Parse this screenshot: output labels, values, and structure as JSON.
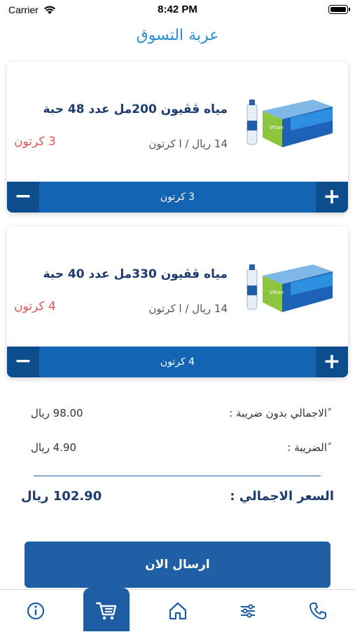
{
  "status_bar": {
    "carrier": "Carrier",
    "time": "8:42 PM"
  },
  "header": {
    "title": "عربة التسوق"
  },
  "cart": {
    "items": [
      {
        "name": "مياه ڤڤيون 200مل عدد 48 حبة",
        "price": "14 ريال / ا كرتون",
        "quantity_text": "3 كرتون",
        "stepper_text": "3 كرتون",
        "minus": "−",
        "plus": "+",
        "image": "water-box-icon"
      },
      {
        "name": "مياه ڤڤيون 330مل عدد 40 حبة",
        "price": "14 ريال / ا كرتون",
        "quantity_text": "4 كرتون",
        "stepper_text": "4 كرتون",
        "minus": "−",
        "plus": "+",
        "image": "water-box-icon"
      }
    ]
  },
  "summary": {
    "subtotal_label": "ًالاجمالي بدون ضريبة :",
    "subtotal_value": "98.00 ريال",
    "tax_label": "ًالضريبة :",
    "tax_value": "4.90 ريال",
    "total_label": "السعر الاجمالي :",
    "total_value": "102.90 ريال"
  },
  "actions": {
    "send_label": "ارسال الان"
  },
  "tab_bar": {
    "items": [
      "info-icon",
      "cart-icon",
      "home-icon",
      "sliders-icon",
      "phone-icon"
    ],
    "active": "cart-icon"
  },
  "colors": {
    "primary": "#1464b4",
    "accent_red": "#e05656",
    "title_blue": "#2a8fd6"
  }
}
